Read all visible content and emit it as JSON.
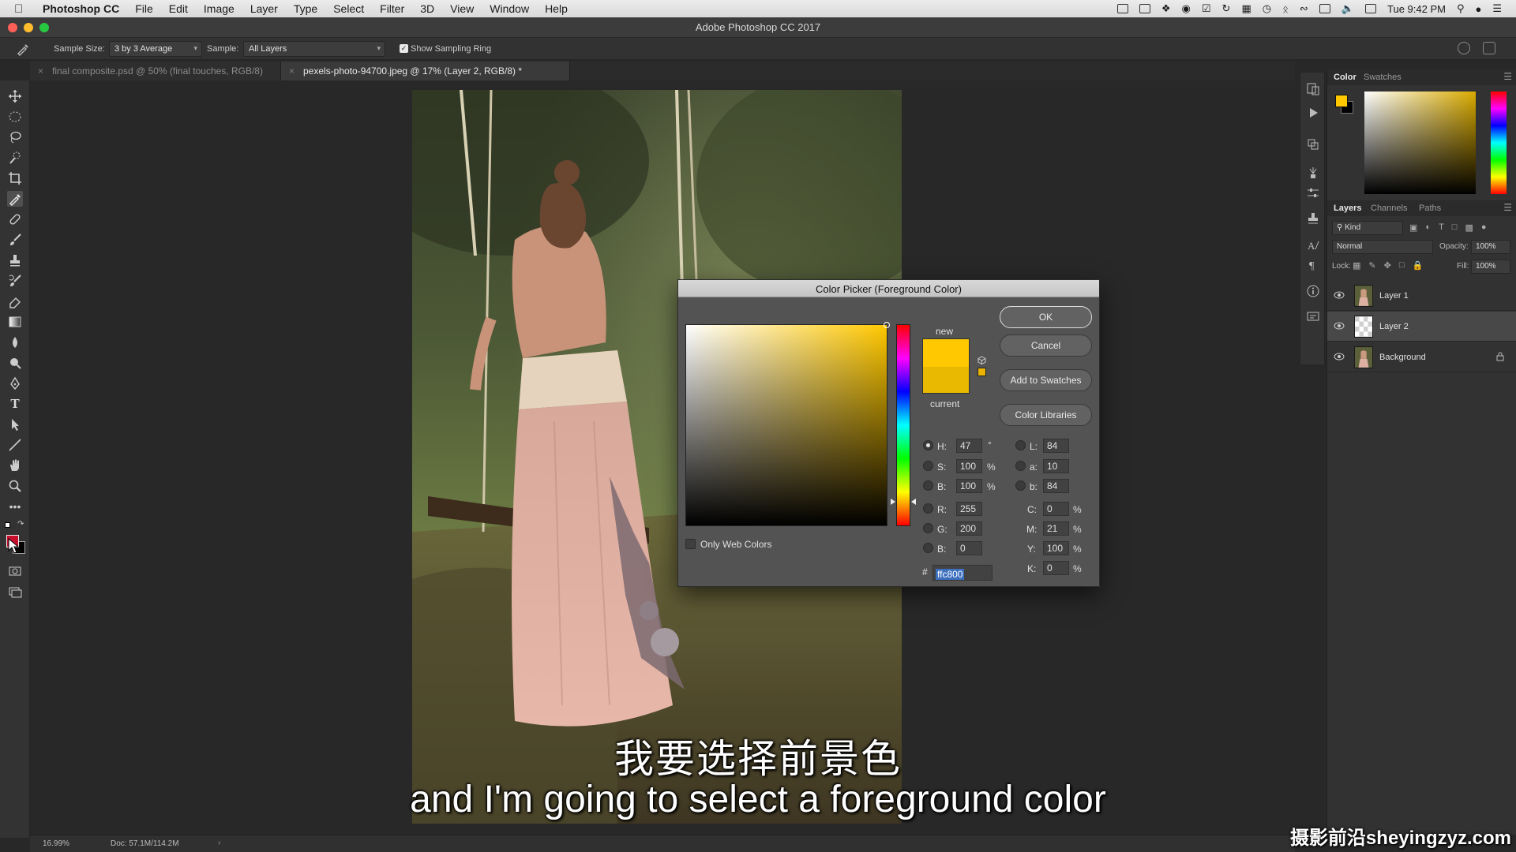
{
  "menubar": {
    "app_name": "Photoshop CC",
    "items": [
      "File",
      "Edit",
      "Image",
      "Layer",
      "Type",
      "Select",
      "Filter",
      "3D",
      "View",
      "Window",
      "Help"
    ],
    "clock": "Tue 9:42 PM"
  },
  "window": {
    "title": "Adobe Photoshop CC 2017"
  },
  "options": {
    "sample_size_label": "Sample Size:",
    "sample_size_value": "3 by 3 Average",
    "sample_label": "Sample:",
    "sample_value": "All Layers",
    "show_ring_label": "Show Sampling Ring",
    "show_ring_checked": true
  },
  "tabs": [
    {
      "label": "final composite.psd @ 50% (final touches, RGB/8)",
      "active": false
    },
    {
      "label": "pexels-photo-94700.jpeg @ 17% (Layer 2, RGB/8) *",
      "active": true
    }
  ],
  "status": {
    "zoom": "16.99%",
    "doc": "Doc: 57.1M/114.2M"
  },
  "dialog": {
    "title": "Color Picker (Foreground Color)",
    "new_label": "new",
    "current_label": "current",
    "new_color": "#ffc800",
    "current_color": "#e8b900",
    "buttons": {
      "ok": "OK",
      "cancel": "Cancel",
      "add": "Add to Swatches",
      "libraries": "Color Libraries"
    },
    "only_web_label": "Only Web Colors",
    "hsb": {
      "h": "47",
      "s": "100",
      "b": "100"
    },
    "rgb": {
      "r": "255",
      "g": "200",
      "b": "0"
    },
    "lab": {
      "l": "84",
      "a": "10",
      "b": "84"
    },
    "cmyk": {
      "c": "0",
      "m": "21",
      "y": "100",
      "k": "0"
    },
    "hex": "ffc800",
    "labels": {
      "h": "H:",
      "s": "S:",
      "bh": "B:",
      "r": "R:",
      "g": "G:",
      "b": "B:",
      "l": "L:",
      "a": "a:",
      "blab": "b:",
      "c": "C:",
      "m": "M:",
      "y": "Y:",
      "k": "K:",
      "hash": "#",
      "deg": "°",
      "pct": "%"
    }
  },
  "color_panel": {
    "tab_color": "Color",
    "tab_swatches": "Swatches",
    "foreground": "#ffc800",
    "background": "#000000"
  },
  "layers_panel": {
    "tab_layers": "Layers",
    "tab_channels": "Channels",
    "tab_paths": "Paths",
    "kind": "Kind",
    "blend_mode": "Normal",
    "opacity_label": "Opacity:",
    "opacity": "100%",
    "lock_label": "Lock:",
    "fill_label": "Fill:",
    "fill": "100%",
    "layers": [
      {
        "name": "Layer 1",
        "selected": false,
        "locked": false
      },
      {
        "name": "Layer 2",
        "selected": true,
        "locked": false
      },
      {
        "name": "Background",
        "selected": false,
        "locked": true
      }
    ]
  },
  "subtitles": {
    "zh": "我要选择前景色",
    "en": "and I'm going to select a foreground color"
  },
  "watermark": "摄影前沿sheyingzyz.com"
}
